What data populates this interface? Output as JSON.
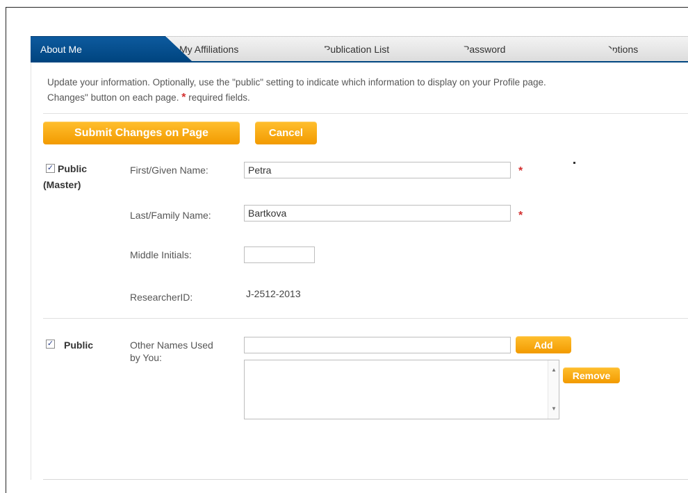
{
  "tabs": [
    {
      "label": "About Me",
      "active": true
    },
    {
      "label": "My Affiliations",
      "active": false
    },
    {
      "label": "Publication List",
      "active": false
    },
    {
      "label": "Password",
      "active": false
    },
    {
      "label": "Options",
      "active": false
    }
  ],
  "intro": {
    "line1": "Update your information. Optionally, use the \"public\" setting to indicate which information to display on your Profile page.",
    "line2": "Changes\" button on each page.",
    "required_star": "*",
    "required_text": "required fields."
  },
  "actions": {
    "submit_label": "Submit Changes on Page",
    "cancel_label": "Cancel"
  },
  "name_section": {
    "public_check": "✓",
    "public_label": "Public",
    "public_sub": "(Master)",
    "first_name_label": "First/Given Name:",
    "first_name_value": "Petra",
    "last_name_label": "Last/Family Name:",
    "last_name_value": "Bartkova",
    "middle_label": "Middle Initials:",
    "middle_value": "",
    "researcherid_label": "ResearcherID:",
    "researcherid_value": "J-2512-2013",
    "required_star": "*"
  },
  "other_names": {
    "public_check": "✓",
    "public_label": "Public",
    "label_line1": "Other Names Used",
    "label_line2": "by You:",
    "input_value": "",
    "add_label": "Add",
    "remove_label": "Remove",
    "scroll_up": "▲",
    "scroll_down": "▼"
  },
  "colors": {
    "active_tab": "#004580",
    "button": "#f29a00",
    "required": "#d32f2f"
  }
}
